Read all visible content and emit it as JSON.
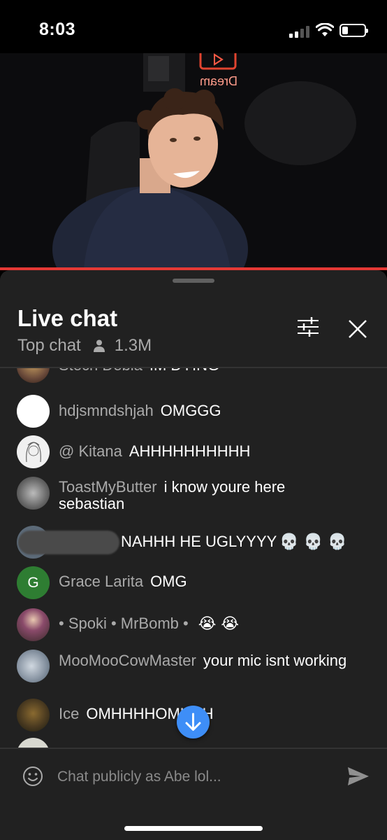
{
  "status_bar": {
    "time": "8:03",
    "icons": [
      "cellular-signal-icon",
      "wifi-icon",
      "battery-icon"
    ],
    "battery_level": 0.25
  },
  "video": {
    "sign_text": "Dream",
    "progress": 1.0,
    "progress_color": "#e53935"
  },
  "chat_header": {
    "title": "Live chat",
    "mode": "Top chat",
    "viewer_count": "1.3M",
    "icons": [
      "person-icon",
      "filter-sliders-icon",
      "close-icon"
    ]
  },
  "messages": [
    {
      "author": "Stech Debla",
      "text": "IM DYING",
      "avatar_color": "#6a4a3a"
    },
    {
      "author": "hdjsmndshjah",
      "text": "OMGGG",
      "avatar_color": "#ffffff"
    },
    {
      "author": "@ Kitana",
      "text": "AHHHHHHHHHH",
      "avatar_color": "#f2f2f2"
    },
    {
      "author": "ToastMyButter",
      "text": "i know youre here sebastian",
      "avatar_color": "#8a8a8a"
    },
    {
      "author": "",
      "text": "NAHHH HE UGLYYYY",
      "emoji": "💀 💀 💀",
      "avatar_color": "#5c6a78"
    },
    {
      "author": "Grace Larita",
      "text": "OMG",
      "avatar_letter": "G",
      "avatar_color": "#2e7d32"
    },
    {
      "author": "• Spoki • MrBomb •",
      "text": "",
      "emoji": "😭 😭",
      "avatar_color": "#6b3e5a"
    },
    {
      "author": "MooMooCowMaster",
      "text": "your mic isnt working",
      "avatar_color": "#9aa4b0"
    },
    {
      "author": "Ice",
      "text": "OMHHHHOMHHH",
      "avatar_color": "#5a4a2a"
    }
  ],
  "input": {
    "placeholder": "Chat publicly as Abe lol...",
    "icons": [
      "emoji-icon",
      "send-icon"
    ]
  },
  "scroll_button": {
    "icon": "arrow-down-icon",
    "color": "#3e8ef7"
  }
}
